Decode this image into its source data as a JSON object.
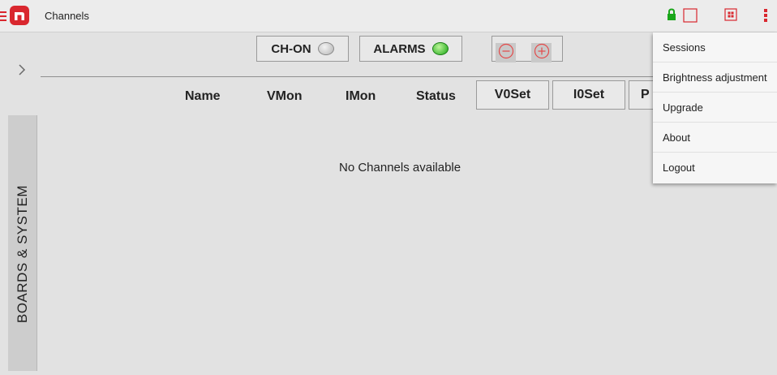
{
  "app": {
    "title": "Channels"
  },
  "colors": {
    "accent": "#d9272e",
    "lock": "#1aa61a",
    "led_green": "#19a614"
  },
  "icons": [
    "menu-icon",
    "logo-icon",
    "lock-icon",
    "square-icon",
    "grid-icon",
    "overflow-menu-icon",
    "chevron-right-icon",
    "minus-circle-icon",
    "plus-circle-icon"
  ],
  "toolbar": {
    "ch_on_label": "CH-ON",
    "alarms_label": "ALARMS"
  },
  "side_tab": {
    "label": "BOARDS & SYSTEM"
  },
  "table": {
    "columns": [
      "Name",
      "VMon",
      "IMon",
      "Status"
    ],
    "set_buttons": [
      "V0Set",
      "I0Set",
      "P"
    ],
    "empty_message": "No Channels available"
  },
  "menu": {
    "items": [
      "Sessions",
      "Brightness adjustment",
      "Upgrade",
      "About",
      "Logout"
    ]
  }
}
